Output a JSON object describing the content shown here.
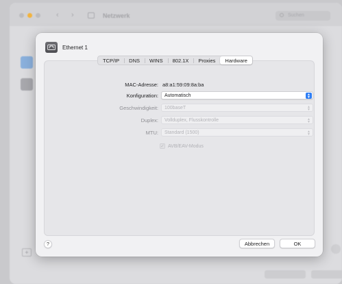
{
  "background_window": {
    "title": "Netzwerk",
    "search_placeholder": "Suchen",
    "nav_back": "‹",
    "nav_forward": "›",
    "add_symbol": "+"
  },
  "sheet": {
    "title": "Ethernet 1",
    "tabs": [
      {
        "label": "TCP/IP",
        "active": false
      },
      {
        "label": "DNS",
        "active": false
      },
      {
        "label": "WINS",
        "active": false
      },
      {
        "label": "802.1X",
        "active": false
      },
      {
        "label": "Proxies",
        "active": false
      },
      {
        "label": "Hardware",
        "active": true
      }
    ],
    "mac": {
      "label": "MAC-Adresse:",
      "value": "a8:a1:59:09:8a:ba"
    },
    "configuration": {
      "label": "Konfiguration:",
      "value": "Automatisch"
    },
    "speed": {
      "label": "Geschwindigkeit:",
      "value": "100baseT"
    },
    "duplex": {
      "label": "Duplex:",
      "value": "Vollduplex, Flusskontrolle"
    },
    "mtu": {
      "label": "MTU:",
      "value": "Standard (1500)"
    },
    "avb": {
      "label": "AVB/EAV-Modus",
      "checked": true
    },
    "help": "?",
    "cancel_label": "Abbrechen",
    "ok_label": "OK"
  },
  "colors": {
    "accent": "#2f7ef5",
    "minimize": "#f3b33d"
  }
}
